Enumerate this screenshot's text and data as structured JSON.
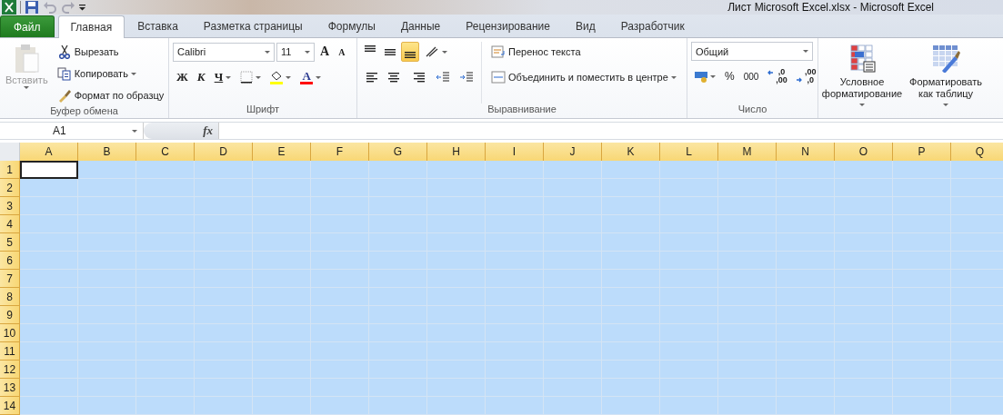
{
  "window": {
    "title": "Лист Microsoft Excel.xlsx  -  Microsoft Excel"
  },
  "quick_access": [
    {
      "kind": "save",
      "disabled": false
    },
    {
      "kind": "undo",
      "disabled": true
    },
    {
      "kind": "redo",
      "disabled": true
    },
    {
      "kind": "customize",
      "disabled": false
    }
  ],
  "tabs": [
    {
      "label": "Файл",
      "kind": "file",
      "selected": false
    },
    {
      "label": "Главная",
      "kind": "tab",
      "selected": true
    },
    {
      "label": "Вставка",
      "kind": "tab",
      "selected": false
    },
    {
      "label": "Разметка страницы",
      "kind": "tab",
      "selected": false
    },
    {
      "label": "Формулы",
      "kind": "tab",
      "selected": false
    },
    {
      "label": "Данные",
      "kind": "tab",
      "selected": false
    },
    {
      "label": "Рецензирование",
      "kind": "tab",
      "selected": false
    },
    {
      "label": "Вид",
      "kind": "tab",
      "selected": false
    },
    {
      "label": "Разработчик",
      "kind": "tab",
      "selected": false
    }
  ],
  "clipboard": {
    "label": "Буфер обмена",
    "paste": {
      "label": "Вставить",
      "disabled": true
    },
    "items": [
      {
        "kind": "cut",
        "label": "Вырезать",
        "dropdown": false
      },
      {
        "kind": "copy",
        "label": "Копировать",
        "dropdown": true
      },
      {
        "kind": "painter",
        "label": "Формат по образцу",
        "dropdown": false
      }
    ]
  },
  "font": {
    "label": "Шрифт",
    "name": "Calibri",
    "size": "11",
    "grow": "A",
    "shrink": "A",
    "styles": [
      {
        "kind": "bold",
        "label": "Ж",
        "dropdown": false
      },
      {
        "kind": "italic",
        "label": "К",
        "dropdown": false
      },
      {
        "kind": "underline",
        "label": "Ч",
        "dropdown": true
      }
    ],
    "font_color_label": "A"
  },
  "alignment": {
    "label": "Выравнивание",
    "vertical": [
      {
        "kind": "top",
        "selected": false
      },
      {
        "kind": "middle",
        "selected": false
      },
      {
        "kind": "bottom",
        "selected": true
      }
    ],
    "horizontal": [
      {
        "kind": "left",
        "selected": false
      },
      {
        "kind": "center",
        "selected": false
      },
      {
        "kind": "right",
        "selected": false
      }
    ],
    "wrap": "Перенос текста",
    "merge": "Объединить и поместить в центре"
  },
  "number": {
    "label": "Число",
    "format": "Общий",
    "percent": "%",
    "thousands": "000",
    "increase_decimal": [
      ",0",
      ",00"
    ],
    "decrease_decimal": [
      ",00",
      ",0"
    ]
  },
  "styles": [
    {
      "kind": "conditional",
      "label": "Условное форматирование"
    },
    {
      "kind": "table",
      "label": "Форматировать как таблицу"
    }
  ],
  "formula_bar": {
    "name_box": "A1",
    "fx": "fx"
  },
  "grid": {
    "range_selected": true,
    "columns": [
      {
        "label": "A",
        "selected": true
      },
      {
        "label": "B",
        "selected": true
      },
      {
        "label": "C",
        "selected": true
      },
      {
        "label": "D",
        "selected": true
      },
      {
        "label": "E",
        "selected": true
      },
      {
        "label": "F",
        "selected": true
      },
      {
        "label": "G",
        "selected": true
      },
      {
        "label": "H",
        "selected": true
      },
      {
        "label": "I",
        "selected": true
      },
      {
        "label": "J",
        "selected": true
      },
      {
        "label": "K",
        "selected": true
      },
      {
        "label": "L",
        "selected": true
      },
      {
        "label": "M",
        "selected": true
      },
      {
        "label": "N",
        "selected": true
      },
      {
        "label": "O",
        "selected": true
      },
      {
        "label": "P",
        "selected": true
      },
      {
        "label": "Q",
        "selected": true
      }
    ],
    "rows": [
      {
        "label": "1",
        "selected": true
      },
      {
        "label": "2",
        "selected": true
      },
      {
        "label": "3",
        "selected": true
      },
      {
        "label": "4",
        "selected": true
      },
      {
        "label": "5",
        "selected": true
      },
      {
        "label": "6",
        "selected": true
      },
      {
        "label": "7",
        "selected": true
      },
      {
        "label": "8",
        "selected": true
      },
      {
        "label": "9",
        "selected": true
      },
      {
        "label": "10",
        "selected": true
      },
      {
        "label": "11",
        "selected": true
      },
      {
        "label": "12",
        "selected": true
      },
      {
        "label": "13",
        "selected": true
      },
      {
        "label": "14",
        "selected": true
      }
    ]
  }
}
